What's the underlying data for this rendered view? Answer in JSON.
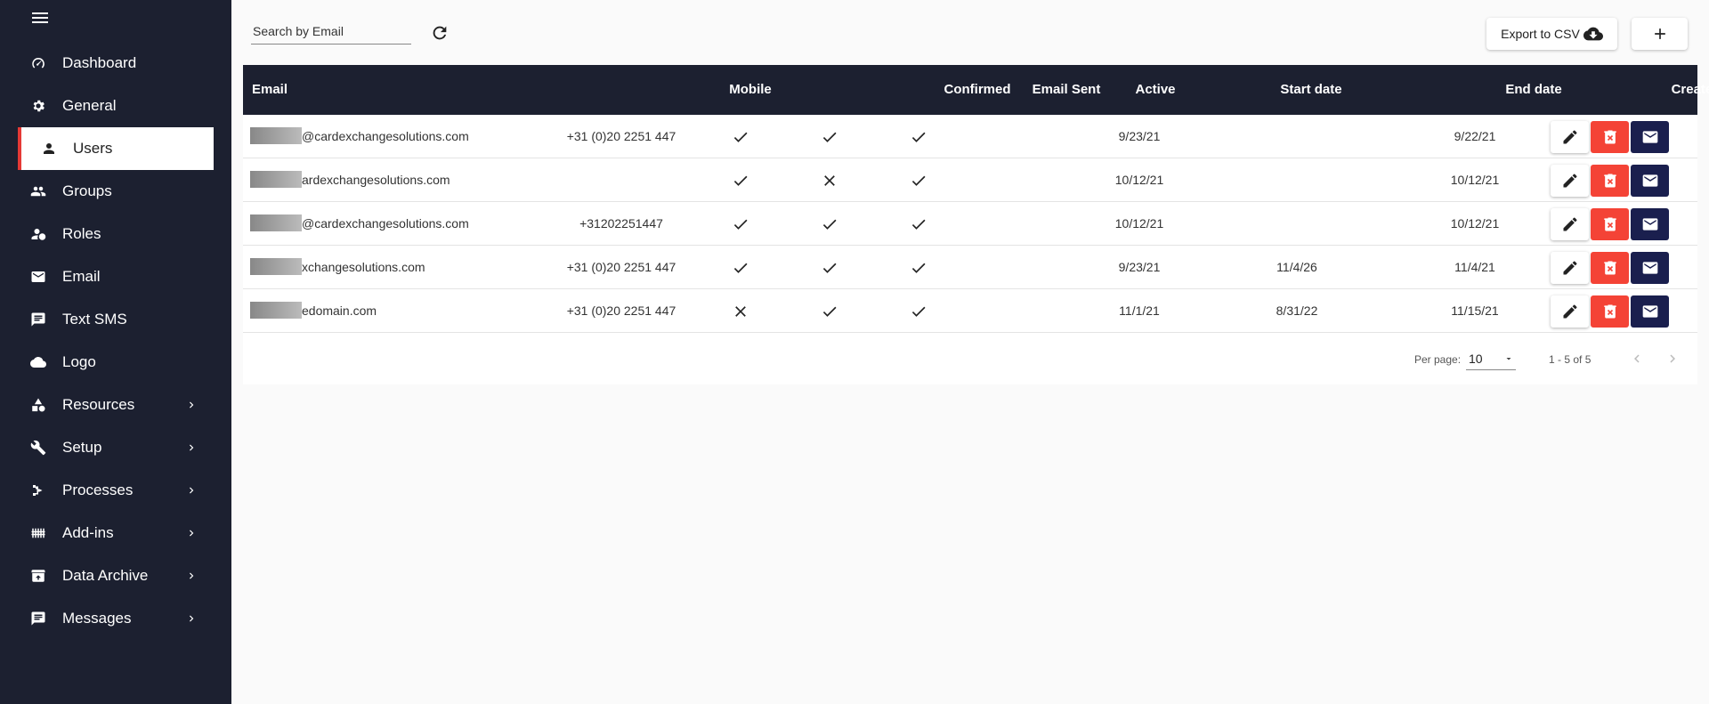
{
  "sidebar": {
    "items": [
      {
        "label": "Dashboard",
        "icon": "dashboard-icon"
      },
      {
        "label": "General",
        "icon": "gear-icon"
      },
      {
        "label": "Users",
        "icon": "person-icon"
      },
      {
        "label": "Groups",
        "icon": "group-icon"
      },
      {
        "label": "Roles",
        "icon": "roles-icon"
      },
      {
        "label": "Email",
        "icon": "email-icon"
      },
      {
        "label": "Text SMS",
        "icon": "sms-icon"
      },
      {
        "label": "Logo",
        "icon": "cloud-icon"
      },
      {
        "label": "Resources",
        "icon": "resources-icon"
      },
      {
        "label": "Setup",
        "icon": "tools-icon"
      },
      {
        "label": "Processes",
        "icon": "processes-icon"
      },
      {
        "label": "Add-ins",
        "icon": "addins-icon"
      },
      {
        "label": "Data Archive",
        "icon": "archive-icon"
      },
      {
        "label": "Messages",
        "icon": "messages-icon"
      }
    ],
    "active": "Users"
  },
  "toolbar": {
    "search_placeholder": "Search by Email",
    "export_label": "Export to CSV"
  },
  "table": {
    "headers": {
      "email": "Email",
      "mobile": "Mobile",
      "confirmed": "Confirmed",
      "email_sent": "Email Sent",
      "active": "Active",
      "start_date": "Start date",
      "end_date": "End date",
      "created_date": "Created date"
    },
    "rows": [
      {
        "email": "@cardexchangesolutions.com",
        "mobile": "+31 (0)20 2251 447",
        "confirmed": true,
        "email_sent": true,
        "active": true,
        "start_date": "9/23/21",
        "end_date": "",
        "created_date": "9/22/21"
      },
      {
        "email": "ardexchangesolutions.com",
        "mobile": "",
        "confirmed": true,
        "email_sent": false,
        "active": true,
        "start_date": "10/12/21",
        "end_date": "",
        "created_date": "10/12/21"
      },
      {
        "email": "@cardexchangesolutions.com",
        "mobile": "+31202251447",
        "confirmed": true,
        "email_sent": true,
        "active": true,
        "start_date": "10/12/21",
        "end_date": "",
        "created_date": "10/12/21"
      },
      {
        "email": "xchangesolutions.com",
        "mobile": "+31 (0)20 2251 447",
        "confirmed": true,
        "email_sent": true,
        "active": true,
        "start_date": "9/23/21",
        "end_date": "11/4/26",
        "created_date": "11/4/21"
      },
      {
        "email": "edomain.com",
        "mobile": "+31 (0)20 2251 447",
        "confirmed": false,
        "email_sent": true,
        "active": true,
        "start_date": "11/1/21",
        "end_date": "8/31/22",
        "created_date": "11/15/21"
      }
    ]
  },
  "pagination": {
    "per_page_label": "Per page:",
    "per_page_value": "10",
    "range": "1 - 5 of 5"
  },
  "colors": {
    "sidebar_bg": "#1c2030",
    "active_accent": "#e53935",
    "delete_button": "#f44336",
    "mail_button": "#1a1f4e"
  }
}
